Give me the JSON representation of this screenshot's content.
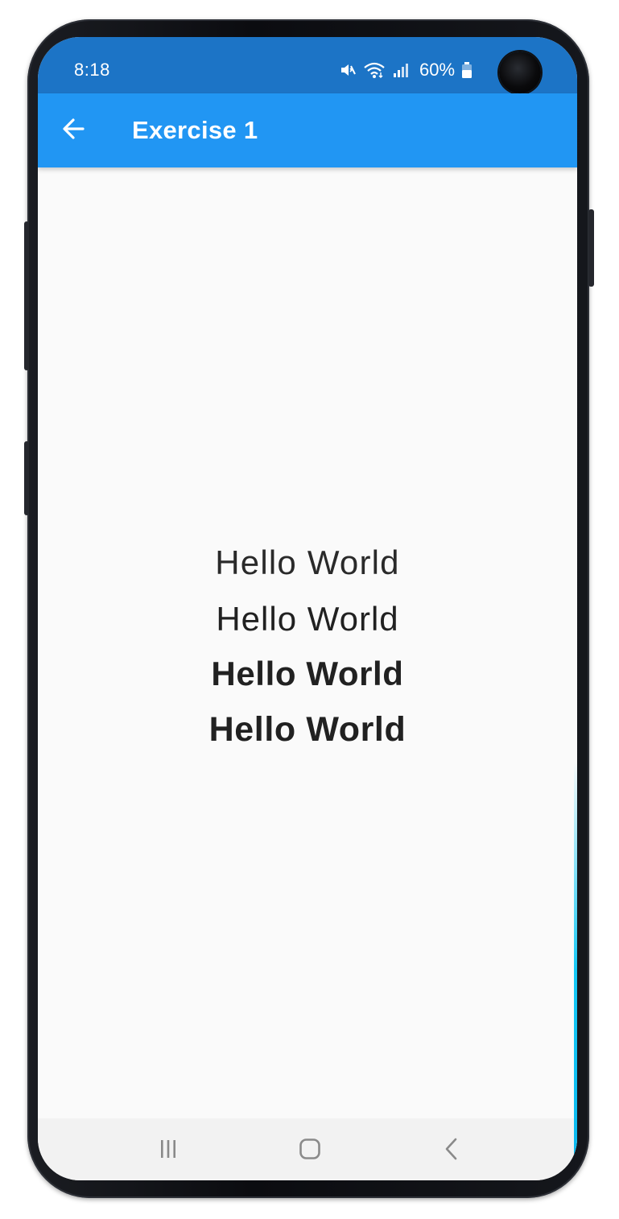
{
  "status_bar": {
    "time": "8:18",
    "battery_percent": "60%",
    "icons": [
      "mute-vibrate-icon",
      "wifi-icon",
      "signal-icon",
      "battery-icon"
    ],
    "background_color": "#1c74c6"
  },
  "app_bar": {
    "title": "Exercise 1",
    "back_icon": "arrow-back-icon",
    "background_color": "#2196f3"
  },
  "content": {
    "lines": [
      {
        "text": "Hello World",
        "weight": "light"
      },
      {
        "text": "Hello World",
        "weight": "regular"
      },
      {
        "text": "Hello World",
        "weight": "bold"
      },
      {
        "text": "Hello World",
        "weight": "extra-bold"
      }
    ],
    "text_color": "#212121",
    "background_color": "#fafafa"
  },
  "nav_bar": {
    "buttons": [
      "recent-apps-icon",
      "home-icon",
      "back-icon"
    ]
  }
}
